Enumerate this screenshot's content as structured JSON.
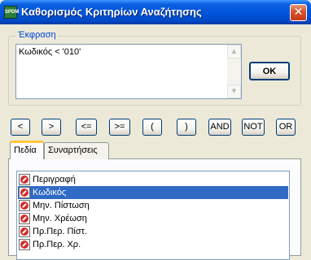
{
  "window": {
    "title": "Καθορισμός Κριτηρίων Αναζήτησης",
    "icon_label": "SPDM",
    "close_glyph": "✕"
  },
  "expression": {
    "group_label": "Έκφραση",
    "value": "Κωδικός < '010'",
    "scroll_up": "▲",
    "scroll_down": "▼"
  },
  "ok_label": "OK",
  "operators": [
    "<",
    ">",
    "<=",
    ">=",
    "(",
    ")",
    "AND",
    "NOT",
    "OR"
  ],
  "tabs": [
    {
      "label": "Πεδία",
      "active": true
    },
    {
      "label": "Συναρτήσεις",
      "active": false
    }
  ],
  "fields": [
    {
      "label": "Περιγραφή",
      "selected": false
    },
    {
      "label": "Κωδικός",
      "selected": true
    },
    {
      "label": "Μην. Πίστωση",
      "selected": false
    },
    {
      "label": "Μην. Χρέωση",
      "selected": false
    },
    {
      "label": "Πρ.Περ. Πίστ.",
      "selected": false
    },
    {
      "label": "Πρ.Περ. Χρ.",
      "selected": false
    }
  ],
  "colors": {
    "titlebar": "#0056dc",
    "selection": "#316ac5",
    "group_label": "#0046d5",
    "field_icon": "#d42a2a"
  }
}
